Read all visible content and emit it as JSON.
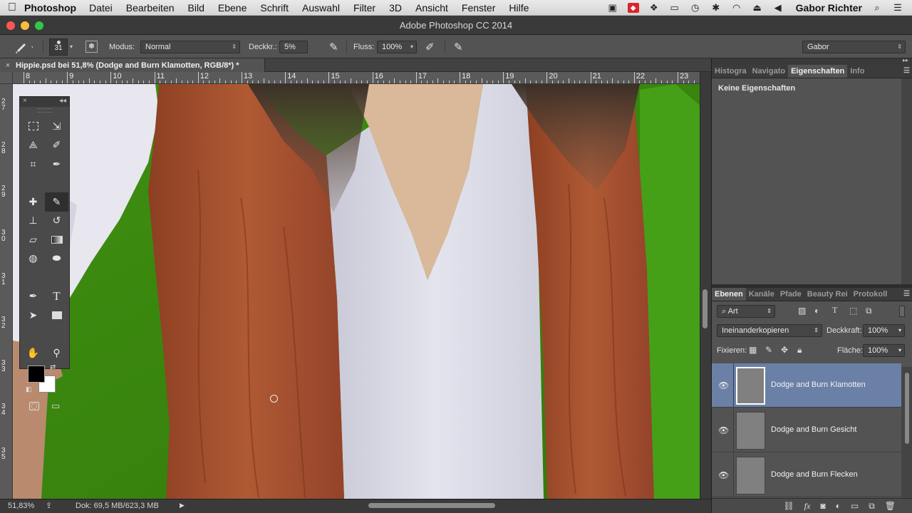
{
  "menubar": {
    "apple_icon": "apple-icon",
    "app_name": "Photoshop",
    "items": [
      "Datei",
      "Bearbeiten",
      "Bild",
      "Ebene",
      "Schrift",
      "Auswahl",
      "Filter",
      "3D",
      "Ansicht",
      "Fenster",
      "Hilfe"
    ],
    "user": "Gabor Richter"
  },
  "window": {
    "title": "Adobe Photoshop CC 2014"
  },
  "options": {
    "brush_size": "31",
    "modus_label": "Modus:",
    "modus_value": "Normal",
    "deckkr_label": "Deckkr.:",
    "deckkr_value": "5%",
    "fluss_label": "Fluss:",
    "fluss_value": "100%",
    "workspace": "Gabor"
  },
  "document": {
    "tab_title": "Hippie.psd bei 51,8% (Dodge and Burn Klamotten, RGB/8*) *",
    "close": "×"
  },
  "ruler": {
    "top_labels": [
      "8",
      "9",
      "10",
      "11",
      "12",
      "13",
      "14",
      "15",
      "16",
      "17",
      "18",
      "19",
      "20",
      "21",
      "22",
      "23"
    ],
    "left_labels": [
      "27",
      "28",
      "29",
      "30",
      "31",
      "32",
      "33",
      "34",
      "35"
    ]
  },
  "tools_panel": {
    "close": "×",
    "collapse": "◂◂"
  },
  "status": {
    "zoom": "51,83%",
    "doc": "Dok: 69,5 MB/623,3 MB"
  },
  "properties": {
    "tabs": [
      "Histogra",
      "Navigato",
      "Eigenschaften",
      "Info"
    ],
    "active_tab": "Eigenschaften",
    "empty_text": "Keine Eigenschaften"
  },
  "layers": {
    "tabs": [
      "Ebenen",
      "Kanäle",
      "Pfade",
      "Beauty Rei",
      "Protokoll"
    ],
    "active_tab": "Ebenen",
    "filter_label": "Art",
    "blend_mode": "Ineinanderkopieren",
    "opacity_label": "Deckkraft:",
    "opacity_value": "100%",
    "lock_label": "Fixieren:",
    "fill_label": "Fläche:",
    "fill_value": "100%",
    "items": [
      {
        "name": "Dodge and Burn Klamotten",
        "selected": true
      },
      {
        "name": "Dodge and Burn Gesicht",
        "selected": false
      },
      {
        "name": "Dodge and Burn Flecken",
        "selected": false
      }
    ]
  },
  "colors": {
    "accent_selection": "#6b80a6",
    "foreground": "#000000",
    "background": "#ffffff",
    "canvas_green": "#3c8a12",
    "jacket_brown": "#a4502e"
  }
}
